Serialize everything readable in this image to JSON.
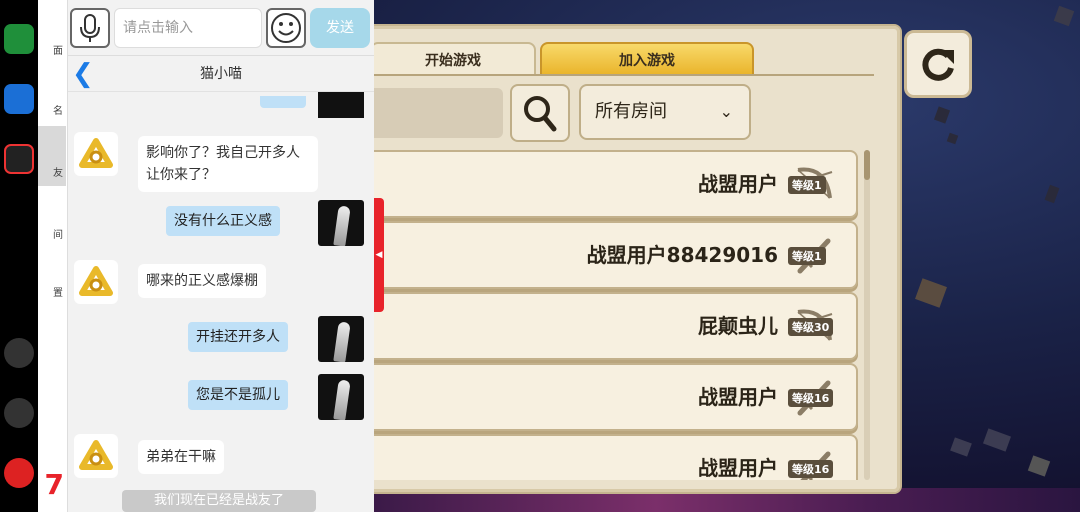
{
  "game": {
    "tabs": [
      {
        "label": "开始游戏",
        "active": false
      },
      {
        "label": "加入游戏",
        "active": true
      }
    ],
    "search": {
      "placeholder": ""
    },
    "filter": {
      "selected": "所有房间",
      "icon": "chevron-down-icon"
    },
    "rooms": [
      {
        "name": "战盟用户",
        "level": "等级1",
        "icon": "bow-icon"
      },
      {
        "name": "战盟用户88429016",
        "level": "等级1",
        "icon": "sword-icon"
      },
      {
        "name": "屁颠虫儿",
        "level": "等级30",
        "icon": "bow-icon"
      },
      {
        "name": "战盟用户",
        "level": "等级16",
        "icon": "sword-icon"
      },
      {
        "name": "战盟用户",
        "level": "等级16",
        "icon": "sword-icon"
      }
    ],
    "refresh_icon": "refresh-icon",
    "accent": "#eab52c"
  },
  "launcher": {
    "items": [
      "面",
      "名",
      "友",
      "间",
      "置"
    ]
  },
  "chat": {
    "input": {
      "placeholder": "请点击输入"
    },
    "send_label": "发送",
    "contact": "猫小喵",
    "messages": [
      {
        "side": "left",
        "text": "影响你了？我自己开多人让你来了？"
      },
      {
        "side": "right",
        "text": "没有什么正义感"
      },
      {
        "side": "left",
        "text": "哪来的正义感爆棚"
      },
      {
        "side": "right",
        "text": "开挂还开多人"
      },
      {
        "side": "right",
        "text": "您是不是孤儿"
      },
      {
        "side": "left",
        "text": "弟弟在干嘛"
      }
    ],
    "bottom_tip": "我们现在已经是战友了"
  }
}
